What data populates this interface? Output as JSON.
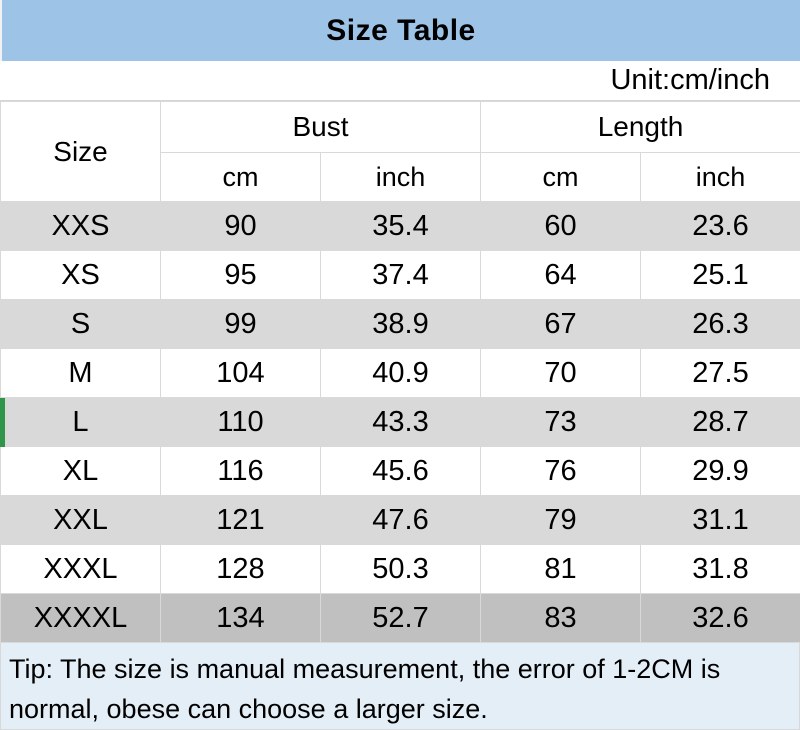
{
  "title": "Size Table",
  "unit_note": "Unit:cm/inch",
  "colors": {
    "title_bar": "#9dc3e6",
    "row_shade": "#d9d9d9",
    "row_plain": "#ffffff",
    "row_last": "#c0c0c0",
    "tip_background": "#e4eef7",
    "grid_line": "#d9d9d9",
    "selection_marker": "#2e9549"
  },
  "headers": {
    "size": "Size",
    "groups": [
      "Bust",
      "Length"
    ],
    "sub": [
      "cm",
      "inch",
      "cm",
      "inch"
    ]
  },
  "rows": [
    {
      "size": "XXS",
      "bust_cm": "90",
      "bust_inch": "35.4",
      "length_cm": "60",
      "length_inch": "23.6"
    },
    {
      "size": "XS",
      "bust_cm": "95",
      "bust_inch": "37.4",
      "length_cm": "64",
      "length_inch": "25.1"
    },
    {
      "size": "S",
      "bust_cm": "99",
      "bust_inch": "38.9",
      "length_cm": "67",
      "length_inch": "26.3"
    },
    {
      "size": "M",
      "bust_cm": "104",
      "bust_inch": "40.9",
      "length_cm": "70",
      "length_inch": "27.5"
    },
    {
      "size": "L",
      "bust_cm": "110",
      "bust_inch": "43.3",
      "length_cm": "73",
      "length_inch": "28.7"
    },
    {
      "size": "XL",
      "bust_cm": "116",
      "bust_inch": "45.6",
      "length_cm": "76",
      "length_inch": "29.9"
    },
    {
      "size": "XXL",
      "bust_cm": "121",
      "bust_inch": "47.6",
      "length_cm": "79",
      "length_inch": "31.1"
    },
    {
      "size": "XXXL",
      "bust_cm": "128",
      "bust_inch": "50.3",
      "length_cm": "81",
      "length_inch": "31.8"
    },
    {
      "size": "XXXXL",
      "bust_cm": "134",
      "bust_inch": "52.7",
      "length_cm": "83",
      "length_inch": "32.6"
    }
  ],
  "tip": "Tip: The size is manual measurement, the error of 1-2CM is normal, obese can choose a larger size."
}
